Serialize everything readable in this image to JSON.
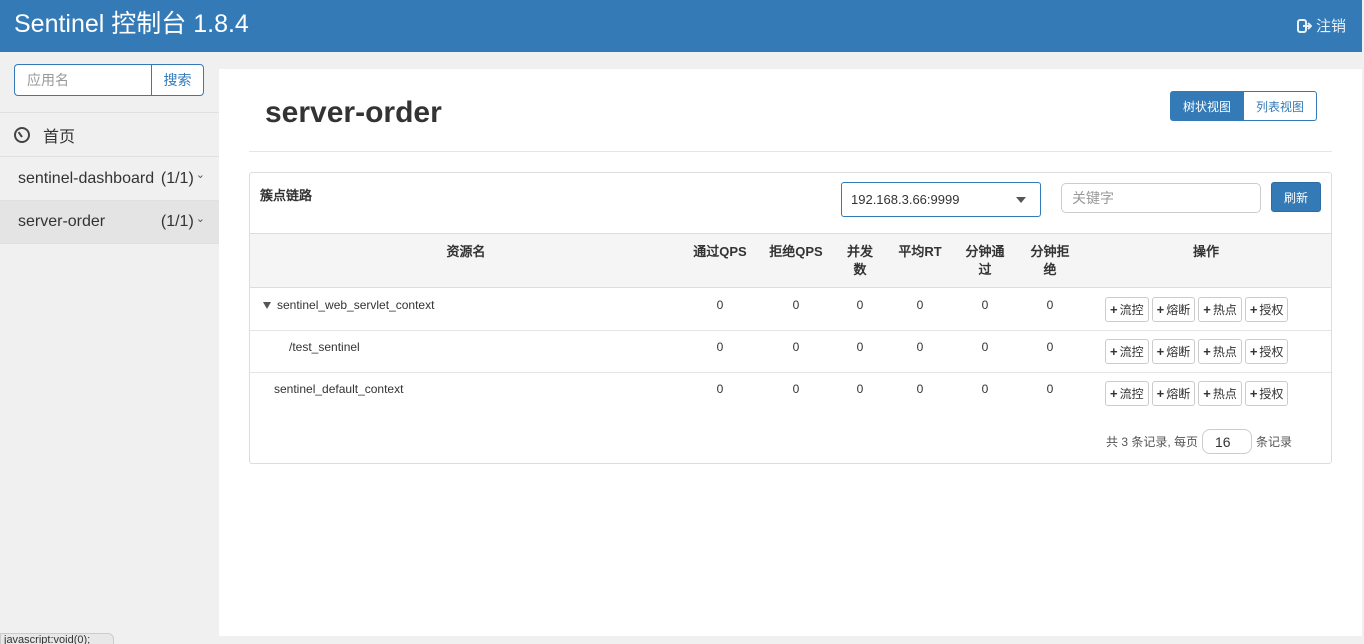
{
  "header": {
    "brand": "Sentinel 控制台 1.8.4",
    "logout_label": "注销"
  },
  "sidebar": {
    "search_placeholder": "应用名",
    "search_button": "搜索",
    "home_label": "首页",
    "apps": [
      {
        "name": "sentinel-dashboard",
        "count": "(1/1)"
      },
      {
        "name": "server-order",
        "count": "(1/1)"
      }
    ]
  },
  "main": {
    "title": "server-order",
    "view_tree": "树状视图",
    "view_list": "列表视图",
    "panel_label": "簇点链路",
    "machine": "192.168.3.66:9999",
    "keyword_placeholder": "关键字",
    "refresh": "刷新",
    "columns": {
      "resource": "资源名",
      "pass_qps": "通过QPS",
      "block_qps": "拒绝QPS",
      "concurrency": "并发数",
      "avg_rt": "平均RT",
      "minute_pass": "分钟通过",
      "minute_block": "分钟拒绝",
      "ops": "操作"
    },
    "rows": [
      {
        "name": "sentinel_web_servlet_context",
        "pass_qps": "0",
        "block_qps": "0",
        "concurrency": "0",
        "avg_rt": "0",
        "minute_pass": "0",
        "minute_block": "0"
      },
      {
        "name": "/test_sentinel",
        "pass_qps": "0",
        "block_qps": "0",
        "concurrency": "0",
        "avg_rt": "0",
        "minute_pass": "0",
        "minute_block": "0"
      },
      {
        "name": "sentinel_default_context",
        "pass_qps": "0",
        "block_qps": "0",
        "concurrency": "0",
        "avg_rt": "0",
        "minute_pass": "0",
        "minute_block": "0"
      }
    ],
    "actions": {
      "flow": "流控",
      "degrade": "熔断",
      "hotspot": "热点",
      "authority": "授权"
    },
    "pager": {
      "prefix": "共 3 条记录, 每页",
      "page_size": "16",
      "suffix": "条记录"
    }
  },
  "statusbar": "javascript:void(0);"
}
